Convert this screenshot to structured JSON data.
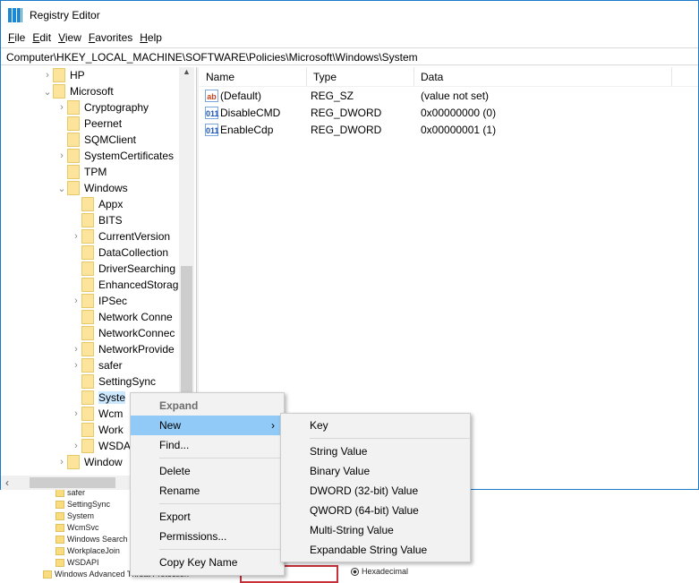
{
  "window": {
    "title": "Registry Editor",
    "icon": "regedit-icon"
  },
  "menubar": [
    "File",
    "Edit",
    "View",
    "Favorites",
    "Help"
  ],
  "address": "Computer\\HKEY_LOCAL_MACHINE\\SOFTWARE\\Policies\\Microsoft\\Windows\\System",
  "tree": [
    {
      "label": "HP",
      "level": 1,
      "expander": "collapsed"
    },
    {
      "label": "Microsoft",
      "level": 1,
      "expander": "expanded"
    },
    {
      "label": "Cryptography",
      "level": 2,
      "expander": "collapsed"
    },
    {
      "label": "Peernet",
      "level": 2,
      "expander": "none"
    },
    {
      "label": "SQMClient",
      "level": 2,
      "expander": "none"
    },
    {
      "label": "SystemCertificates",
      "level": 2,
      "expander": "collapsed"
    },
    {
      "label": "TPM",
      "level": 2,
      "expander": "none"
    },
    {
      "label": "Windows",
      "level": 2,
      "expander": "expanded"
    },
    {
      "label": "Appx",
      "level": 3,
      "expander": "none"
    },
    {
      "label": "BITS",
      "level": 3,
      "expander": "none"
    },
    {
      "label": "CurrentVersion",
      "level": 3,
      "expander": "collapsed"
    },
    {
      "label": "DataCollection",
      "level": 3,
      "expander": "none"
    },
    {
      "label": "DriverSearching",
      "level": 3,
      "expander": "none"
    },
    {
      "label": "EnhancedStorag",
      "level": 3,
      "expander": "none"
    },
    {
      "label": "IPSec",
      "level": 3,
      "expander": "collapsed"
    },
    {
      "label": "Network Conne",
      "level": 3,
      "expander": "none"
    },
    {
      "label": "NetworkConnec",
      "level": 3,
      "expander": "none"
    },
    {
      "label": "NetworkProvide",
      "level": 3,
      "expander": "collapsed"
    },
    {
      "label": "safer",
      "level": 3,
      "expander": "collapsed"
    },
    {
      "label": "SettingSync",
      "level": 3,
      "expander": "none"
    },
    {
      "label": "Syste",
      "level": 3,
      "expander": "none",
      "selected": true
    },
    {
      "label": "Wcm",
      "level": 3,
      "expander": "collapsed"
    },
    {
      "label": "Work",
      "level": 3,
      "expander": "none"
    },
    {
      "label": "WSDA",
      "level": 3,
      "expander": "collapsed"
    },
    {
      "label": "Window",
      "level": 2,
      "expander": "collapsed"
    }
  ],
  "columns": [
    "Name",
    "Type",
    "Data"
  ],
  "values": [
    {
      "name": "(Default)",
      "type": "REG_SZ",
      "data": "(value not set)",
      "icon": "string-value-icon",
      "glyph": "ab",
      "color": "#c8411e"
    },
    {
      "name": "DisableCMD",
      "type": "REG_DWORD",
      "data": "0x00000000 (0)",
      "icon": "binary-value-icon",
      "glyph": "011",
      "color": "#1b56b8"
    },
    {
      "name": "EnableCdp",
      "type": "REG_DWORD",
      "data": "0x00000001 (1)",
      "icon": "binary-value-icon",
      "glyph": "011",
      "color": "#1b56b8"
    }
  ],
  "context_menu": {
    "expand": "Expand",
    "new": "New",
    "find": "Find...",
    "delete": "Delete",
    "rename": "Rename",
    "export": "Export",
    "permissions": "Permissions...",
    "copy_key_name": "Copy Key Name"
  },
  "submenu": {
    "key": "Key",
    "items": [
      "String Value",
      "Binary Value",
      "DWORD (32-bit) Value",
      "QWORD (64-bit) Value",
      "Multi-String Value",
      "Expandable String Value"
    ]
  },
  "background_window": {
    "tree": [
      "safer",
      "SettingSync",
      "System",
      "WcmSvc",
      "Windows Search",
      "WorkplaceJoin",
      "WSDAPI",
      "Windows Advanced Threat Protection"
    ],
    "radio": "Hexadecimal"
  },
  "colors": {
    "highlight": "#91c9f7",
    "selection": "#cce8ff",
    "border": "#1979ca"
  }
}
